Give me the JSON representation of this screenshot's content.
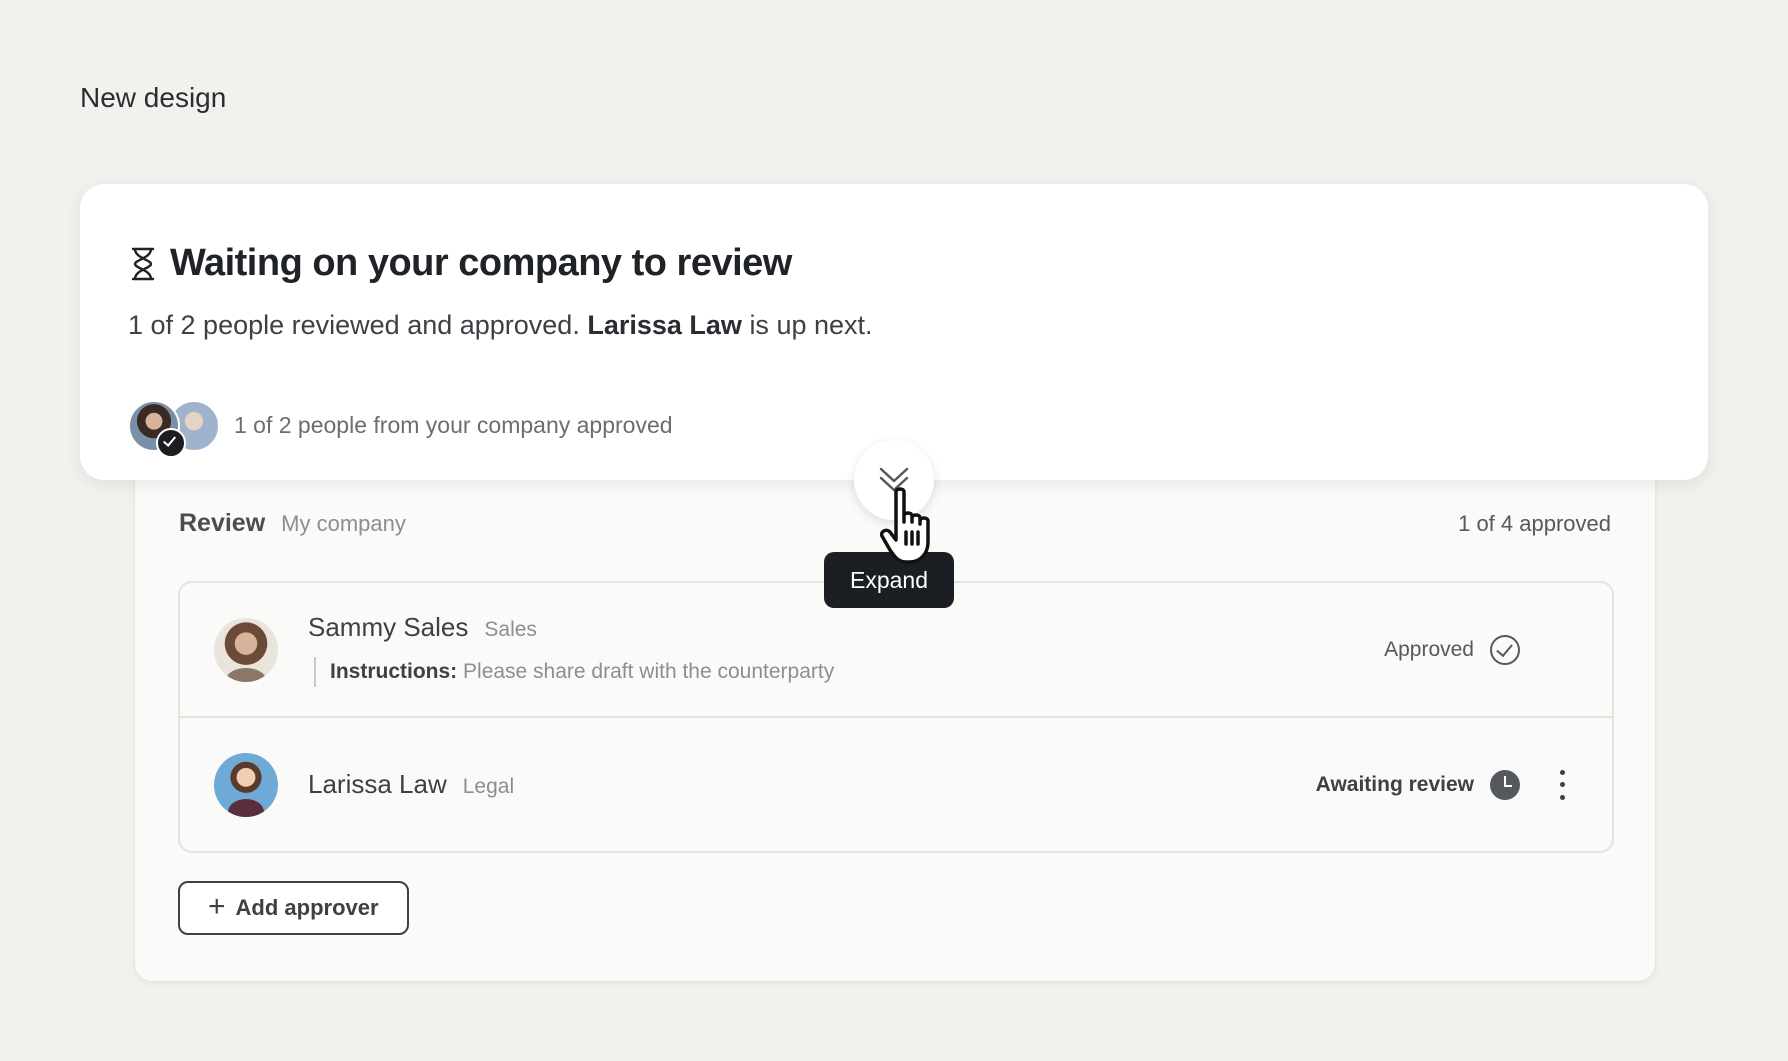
{
  "page": {
    "title": "New design"
  },
  "status_card": {
    "title": "Waiting on your company to review",
    "summary_prefix": "1 of 2 people reviewed and approved.",
    "next_person": "Larissa Law",
    "summary_suffix": "is up next.",
    "footer_text": "1 of 2 people from your company approved"
  },
  "expand": {
    "tooltip": "Expand"
  },
  "review": {
    "label": "Review",
    "company": "My company",
    "count": "1 of 4 approved",
    "approvers": [
      {
        "name": "Sammy Sales",
        "department": "Sales",
        "instructions_label": "Instructions:",
        "instructions": "Please share draft with the counterparty",
        "status": "Approved"
      },
      {
        "name": "Larissa Law",
        "department": "Legal",
        "status": "Awaiting review"
      }
    ],
    "add_button": "Add approver"
  }
}
